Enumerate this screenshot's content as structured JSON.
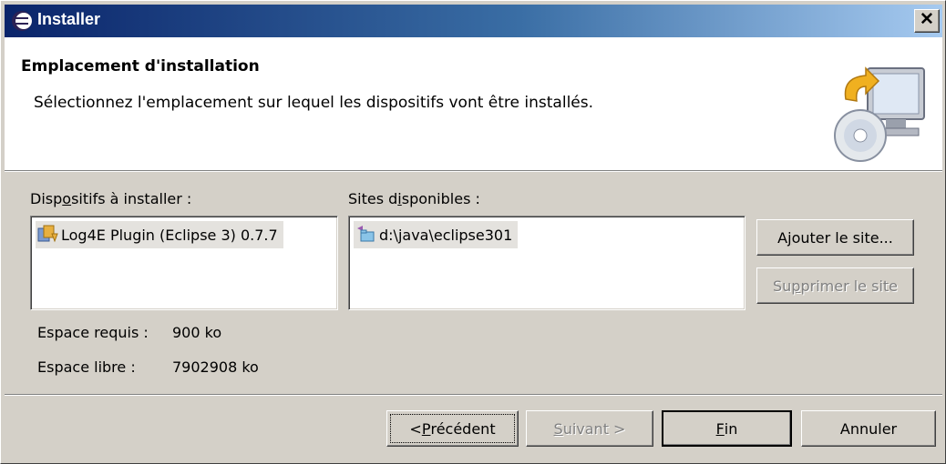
{
  "window": {
    "title": "Installer",
    "close_glyph": "✕"
  },
  "header": {
    "title": "Emplacement d'installation",
    "description": "Sélectionnez l'emplacement sur lequel les dispositifs vont être installés.",
    "icon": "install-computer-cd-icon"
  },
  "features": {
    "label_pre": "Disp",
    "label_mnemonic": "o",
    "label_post": "sitifs à installer :",
    "items": [
      {
        "label": "Log4E Plugin (Eclipse 3) 0.7.7",
        "icon": "plugin-feature-icon"
      }
    ]
  },
  "sites": {
    "label_pre": "Sites d",
    "label_mnemonic": "i",
    "label_post": "sponibles :",
    "items": [
      {
        "label": "d:\\java\\eclipse301",
        "icon": "site-folder-icon"
      }
    ],
    "add_pre": "A",
    "add_mnemonic": "j",
    "add_post": "outer le site...",
    "remove_pre": "Su",
    "remove_mnemonic": "p",
    "remove_post": "primer le site"
  },
  "space": {
    "required_label": "Espace requis :",
    "required_value": "900 ko",
    "free_label": "Espace libre :",
    "free_value": "7902908 ko"
  },
  "nav": {
    "back_pre": "< ",
    "back_mnemonic": "P",
    "back_post": "récédent",
    "next_mnemonic": "S",
    "next_post": "uivant >",
    "finish_mnemonic": "F",
    "finish_post": "in",
    "cancel": "Annuler"
  }
}
